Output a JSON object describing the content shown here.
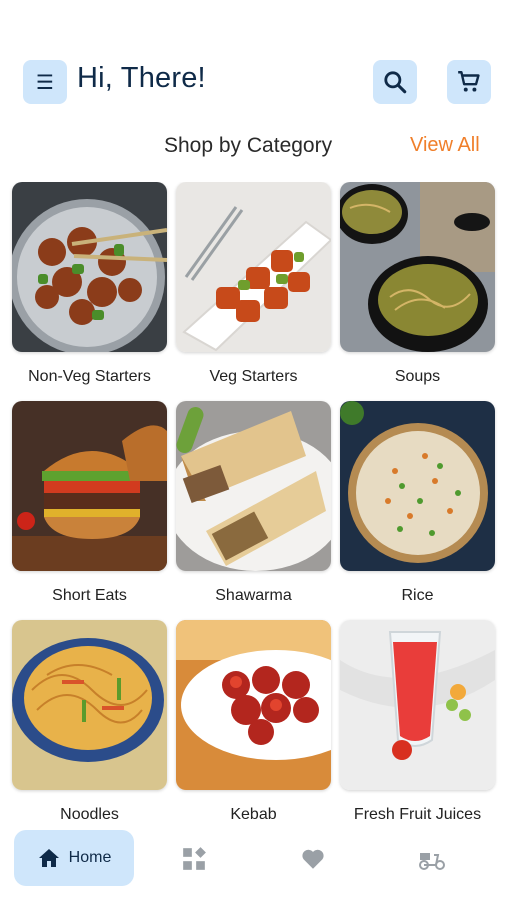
{
  "header": {
    "greeting": "Hi, There!",
    "menu_icon": "menu-icon",
    "search_icon": "search-icon",
    "cart_icon": "cart-icon"
  },
  "section": {
    "title": "Shop by Category",
    "view_all": "View All"
  },
  "categories": [
    {
      "label": "Non-Veg Starters",
      "image": "chili-chicken-photo"
    },
    {
      "label": "Veg Starters",
      "image": "chili-paneer-photo"
    },
    {
      "label": "Soups",
      "image": "noodle-soup-photo"
    },
    {
      "label": "Short Eats",
      "image": "burger-photo"
    },
    {
      "label": "Shawarma",
      "image": "shawarma-wrap-photo"
    },
    {
      "label": "Rice",
      "image": "fried-rice-photo"
    },
    {
      "label": "Noodles",
      "image": "noodles-photo"
    },
    {
      "label": "Kebab",
      "image": "kebab-photo"
    },
    {
      "label": "Fresh Fruit Juices",
      "image": "juice-photo"
    }
  ],
  "bottom_nav": {
    "home_label": "Home",
    "items": [
      "home-icon",
      "categories-icon",
      "heart-icon",
      "delivery-scooter-icon"
    ]
  },
  "colors": {
    "accent_light": "#cfe6fb",
    "brand_dark": "#0f2a48",
    "view_all": "#f07f2a"
  }
}
